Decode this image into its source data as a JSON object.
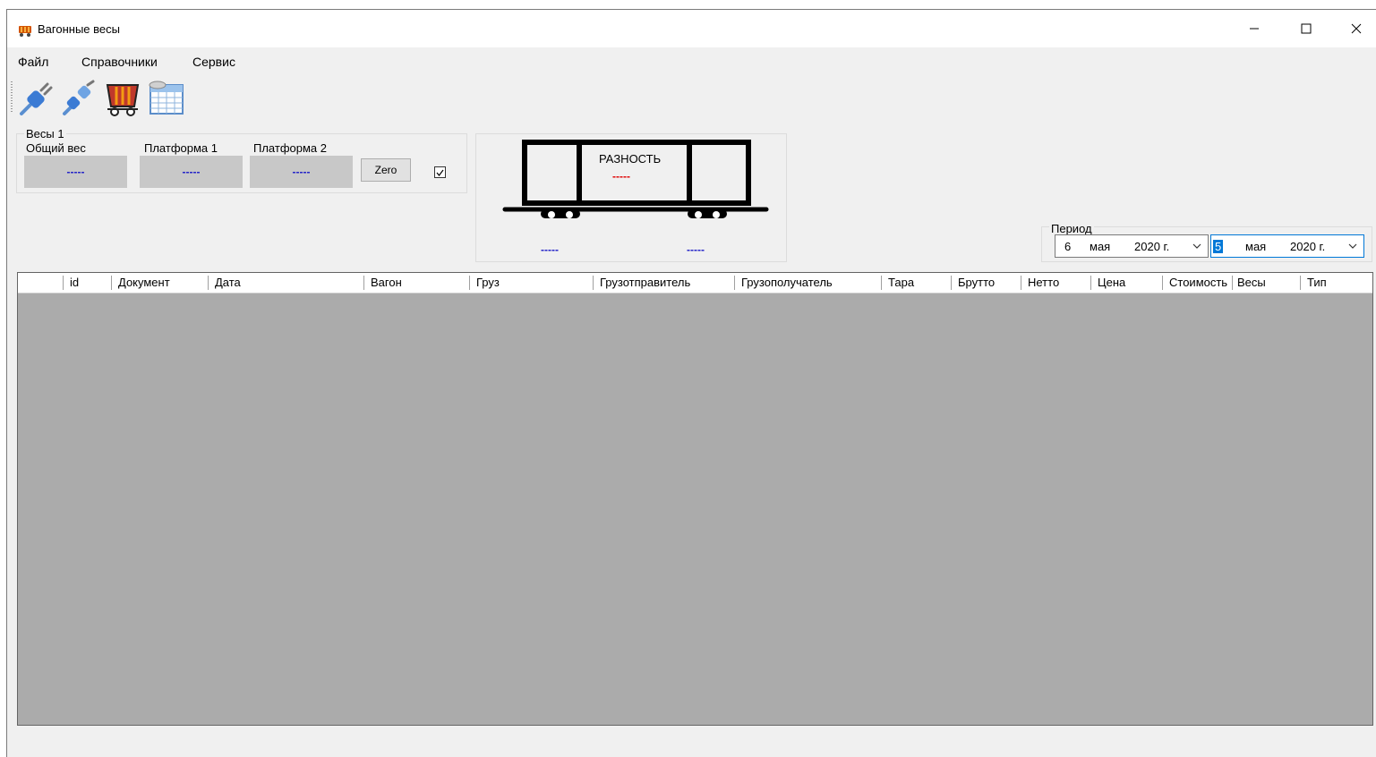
{
  "window": {
    "title": "Вагонные весы"
  },
  "menu": [
    {
      "label": "Файл"
    },
    {
      "label": "Справочники"
    },
    {
      "label": "Сервис"
    }
  ],
  "toolbar": [
    {
      "icon": "connect-plug-icon"
    },
    {
      "icon": "disconnect-plug-icon"
    },
    {
      "icon": "wagon-cart-icon"
    },
    {
      "icon": "table-icon"
    }
  ],
  "scale": {
    "group_title": "Весы 1",
    "total_label": "Общий вес",
    "platform1_label": "Платформа 1",
    "platform2_label": "Платформа 2",
    "total_value": "-----",
    "platform1_value": "-----",
    "platform2_value": "-----",
    "zero_button": "Zero",
    "checkbox_checked": true
  },
  "wagon": {
    "difference_label": "РАЗНОСТЬ",
    "difference_value": "-----",
    "left_value": "-----",
    "right_value": "-----",
    "difference_color": "#e00000",
    "value_color": "#2020c8"
  },
  "period": {
    "label": "Период",
    "from": {
      "day": "6",
      "month": "мая",
      "year": "2020 г."
    },
    "to": {
      "day": "5",
      "month": "мая",
      "year": "2020 г."
    }
  },
  "grid": {
    "columns": [
      "",
      "id",
      "Документ",
      "Дата",
      "Вагон",
      "Груз",
      "Грузотправитель",
      "Грузополучатель",
      "Тара",
      "Брутто",
      "Нетто",
      "Цена",
      "Стоимость",
      "Весы",
      "Тип"
    ],
    "rows": []
  }
}
